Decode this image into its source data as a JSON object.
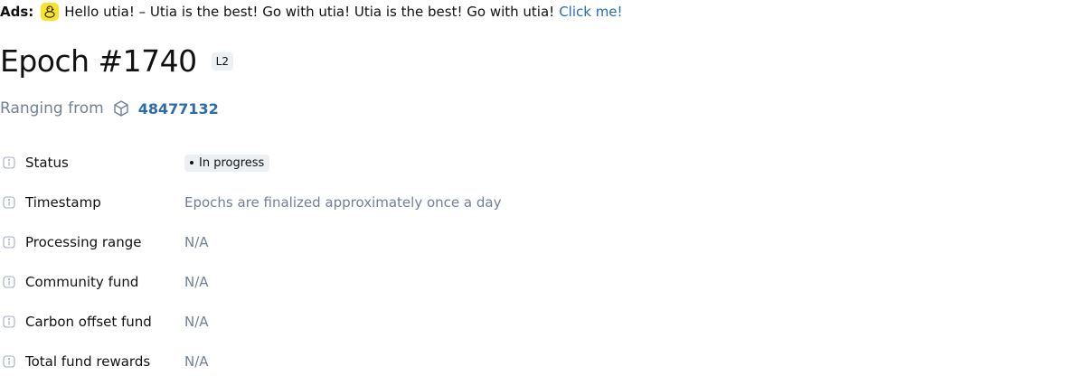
{
  "ads": {
    "label": "Ads:",
    "logo_icon": "utia-duck-icon",
    "text": "Hello utia! – Utia is the best! Go with utia! Utia is the best! Go with utia!",
    "link_text": "Click me!",
    "logo_color": "#f6e42c"
  },
  "header": {
    "title": "Epoch #1740",
    "badge": "L2"
  },
  "range": {
    "label": "Ranging from",
    "icon": "cube-icon",
    "block_number": "48477132"
  },
  "details": {
    "status": {
      "label": "Status",
      "value": "In progress"
    },
    "timestamp": {
      "label": "Timestamp",
      "value": "Epochs are finalized approximately once a day"
    },
    "processing_range": {
      "label": "Processing range",
      "value": "N/A"
    },
    "community_fund": {
      "label": "Community fund",
      "value": "N/A"
    },
    "carbon_offset_fund": {
      "label": "Carbon offset fund",
      "value": "N/A"
    },
    "total_fund_rewards": {
      "label": "Total fund rewards",
      "value": "N/A"
    }
  },
  "colors": {
    "link": "#2b6cb0",
    "muted": "#718096",
    "badge_bg": "#edf0f3"
  }
}
